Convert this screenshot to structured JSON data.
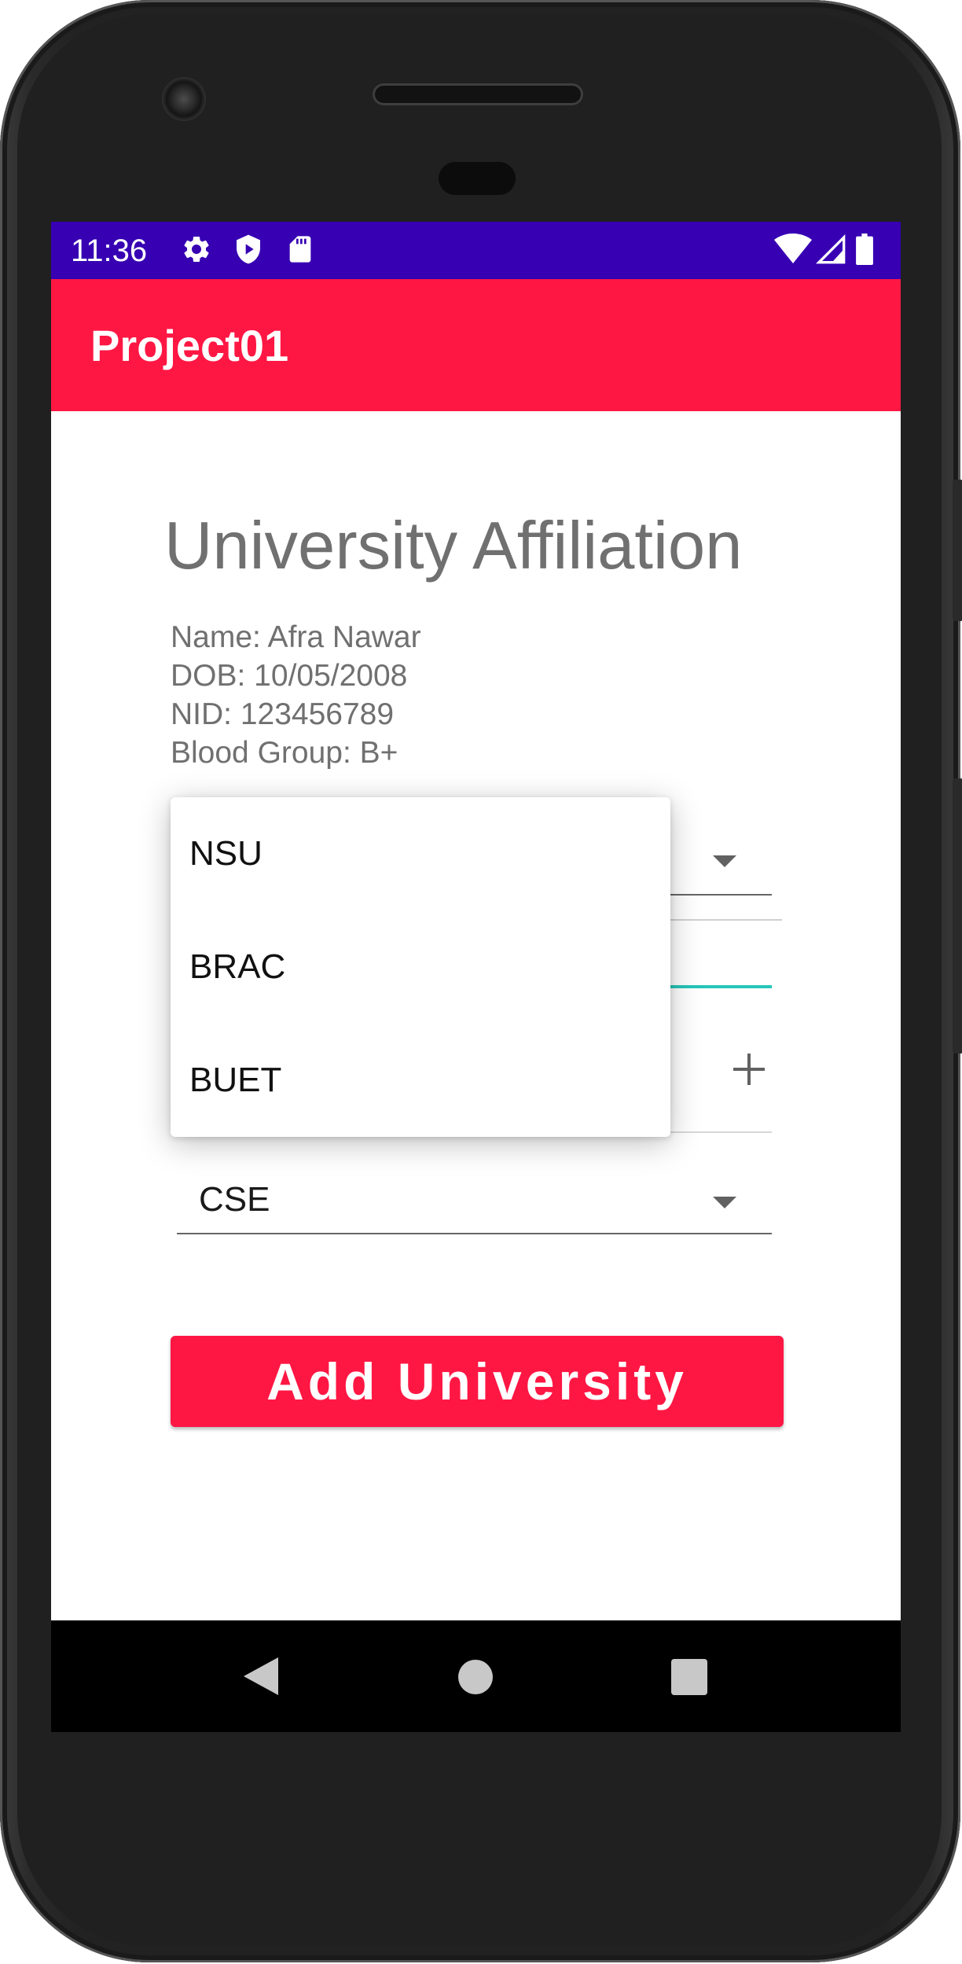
{
  "status_bar": {
    "time": "11:36",
    "icons": [
      "gear-icon",
      "shield-play-icon",
      "sd-card-icon",
      "wifi-icon",
      "signal-icon",
      "battery-icon"
    ],
    "color": "#3700b3"
  },
  "app_bar": {
    "title": "Project01",
    "color": "#ff1744"
  },
  "page": {
    "heading": "University Affiliation",
    "info": {
      "name": "Name: Afra Nawar",
      "dob": "DOB: 10/05/2008",
      "nid": "NID: 123456789",
      "blood_group": "Blood Group: B+"
    }
  },
  "university_dropdown": {
    "options": [
      "NSU",
      "BRAC",
      "BUET"
    ]
  },
  "department_spinner": {
    "selected": "CSE"
  },
  "add_button": {
    "label": "Add University"
  },
  "nav_bar": {
    "buttons": [
      "back-icon",
      "home-icon",
      "recents-icon"
    ]
  },
  "colors": {
    "accent": "#ff1744",
    "status": "#3700b3",
    "field_focus": "#26c6b8",
    "muted_text": "#707070"
  }
}
